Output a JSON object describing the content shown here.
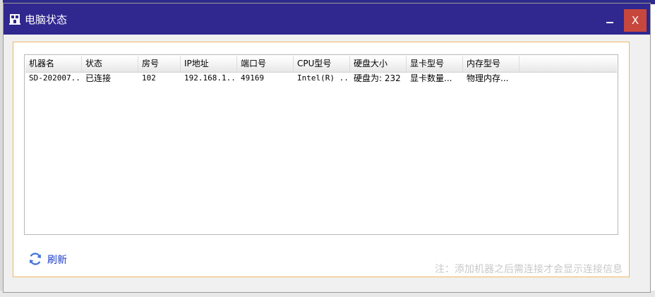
{
  "window": {
    "title": "电脑状态",
    "close_label": "X"
  },
  "table": {
    "columns": [
      "机器名",
      "状态",
      "房号",
      "IP地址",
      "端口号",
      "CPU型号",
      "硬盘大小",
      "显卡型号",
      "内存型号"
    ],
    "rows": [
      [
        "SD-202007...",
        "已连接",
        "102",
        "192.168.1...",
        "49169",
        "Intel(R) ...",
        "硬盘为: 232",
        "显卡数量...",
        "物理内存..."
      ]
    ]
  },
  "footer": {
    "refresh_label": "刷新",
    "note": "注：添加机器之后需连接才会显示连接信息"
  },
  "colors": {
    "titlebar": "#30278f",
    "close_button": "#c8473d",
    "panel_border": "#f0b860",
    "link": "#1a3bc7"
  }
}
